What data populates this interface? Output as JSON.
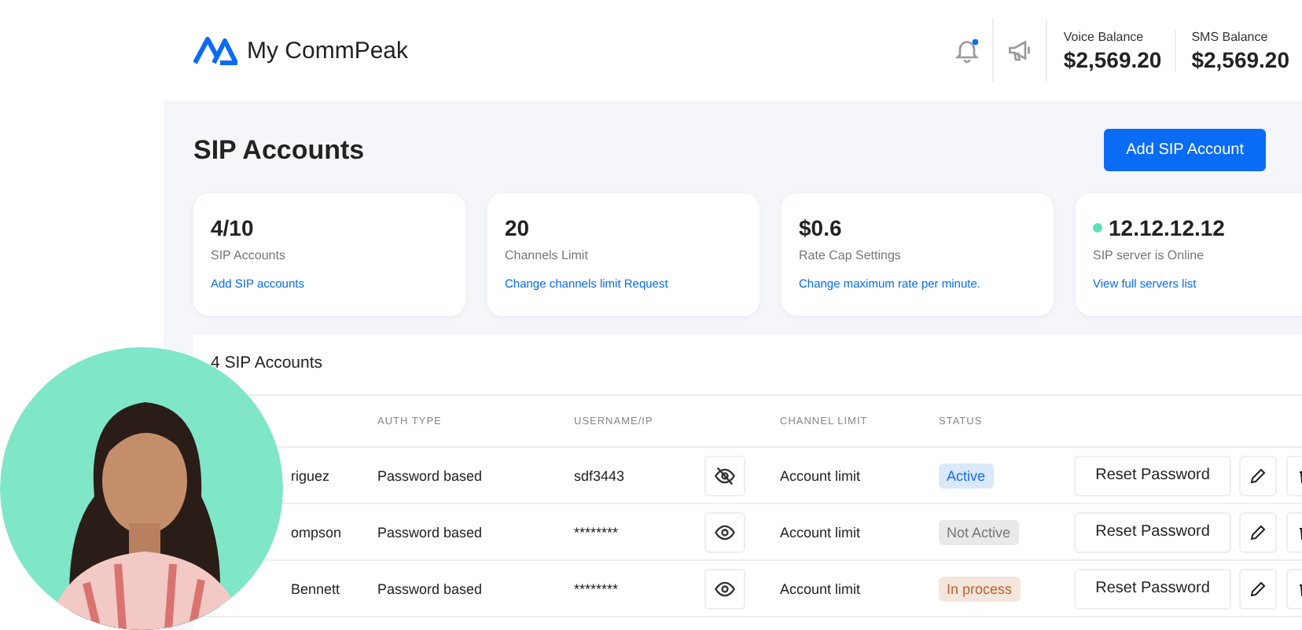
{
  "header": {
    "app_name": "My CommPeak",
    "notifications": {
      "unread": true
    },
    "balances": [
      {
        "label": "Voice Balance",
        "amount": "$2,569.20"
      },
      {
        "label": "SMS Balance",
        "amount": "$2,569.20"
      }
    ]
  },
  "page": {
    "title": "SIP Accounts",
    "add_button": "Add SIP Account"
  },
  "stats": [
    {
      "value": "4/10",
      "label": "SIP Accounts",
      "link": "Add SIP accounts",
      "online": false
    },
    {
      "value": "20",
      "label": "Channels Limit",
      "link": "Change channels limit Request",
      "online": false
    },
    {
      "value": "$0.6",
      "label": "Rate Cap Settings",
      "link": "Change maximum rate per minute.",
      "online": false
    },
    {
      "value": "12.12.12.12",
      "label": "SIP server is Online",
      "link": "View full servers list",
      "online": true
    }
  ],
  "table": {
    "title": "4 SIP Accounts",
    "columns": [
      "AUTH TYPE",
      "USERNAME/IP",
      "CHANNEL LIMIT",
      "STATUS"
    ],
    "rows": [
      {
        "name": "riguez",
        "auth_type": "Password based",
        "username": "sdf3443",
        "revealed": true,
        "channel_limit": "Account limit",
        "status": "Active",
        "color": "#1a6ee8",
        "action": "Reset Password"
      },
      {
        "name": "ompson",
        "auth_type": "Password based",
        "username": "********",
        "revealed": false,
        "channel_limit": "Account limit",
        "status": "Not Active",
        "color": "#777777",
        "action": "Reset Password"
      },
      {
        "name": "Bennett",
        "auth_type": "Password based",
        "username": "********",
        "revealed": false,
        "channel_limit": "Account limit",
        "status": "In process",
        "color": "#b9632a",
        "action": "Reset Password"
      }
    ]
  }
}
